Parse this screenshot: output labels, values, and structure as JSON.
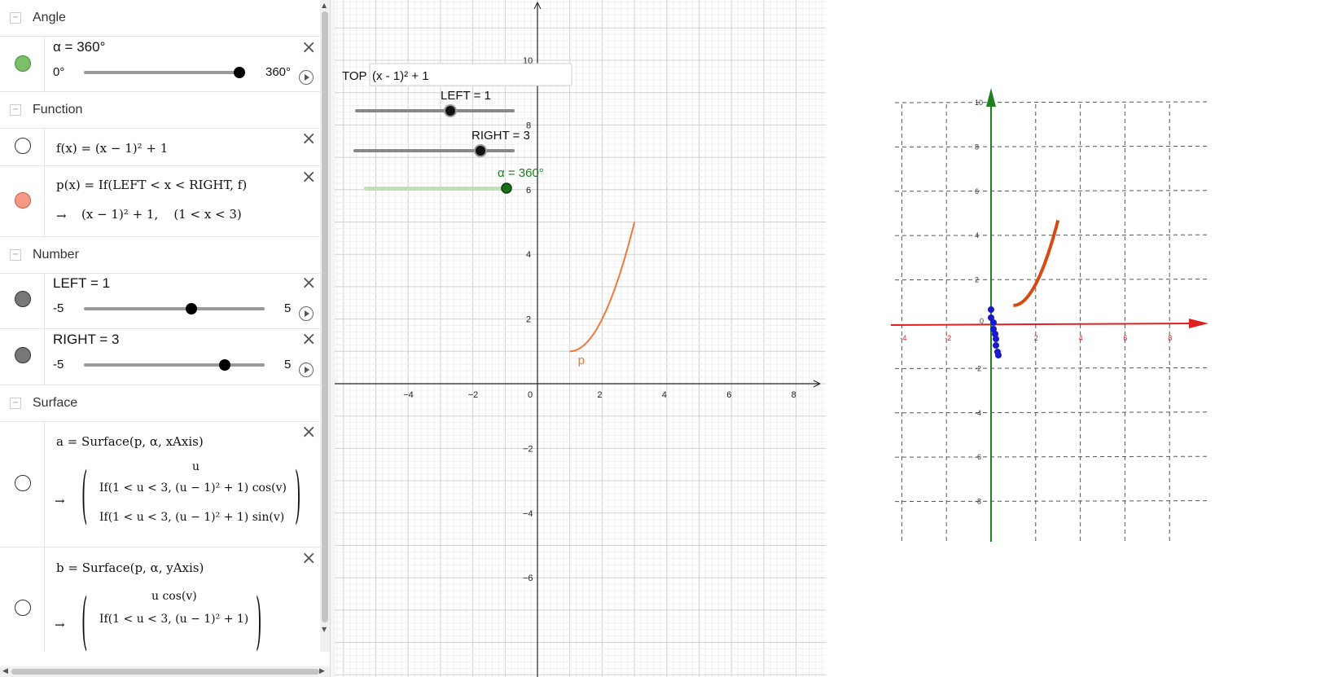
{
  "algebra": {
    "groups": {
      "angle": "Angle",
      "function": "Function",
      "number": "Number",
      "surface": "Surface"
    },
    "alpha": {
      "label": "α = 360°",
      "min": "0°",
      "max": "360°",
      "value": 360,
      "range": [
        0,
        360
      ],
      "marble_color": "#7bbf6a"
    },
    "f": {
      "definition": "f(x) = (x − 1)² + 1",
      "marble_color": "#ffffff"
    },
    "p": {
      "definition": "p(x) = If(LEFT < x < RIGHT, f)",
      "arrow": "→",
      "output": "(x − 1)² + 1,    (1 < x < 3)",
      "marble_color": "#f49a84"
    },
    "left": {
      "label": "LEFT = 1",
      "min": "-5",
      "max": "5",
      "value": 1,
      "range": [
        -5,
        5
      ]
    },
    "right": {
      "label": "RIGHT = 3",
      "min": "-5",
      "max": "5",
      "value": 3,
      "range": [
        -5,
        5
      ]
    },
    "a": {
      "definition": "a = Surface(p, α, xAxis)",
      "arrow": "→",
      "row1": "u",
      "row2": "If(1 < u < 3, (u − 1)² + 1)  cos(v)",
      "row3": "If(1 < u < 3, (u − 1)² + 1)  sin(v)"
    },
    "b": {
      "definition": "b = Surface(p, α, yAxis)",
      "arrow": "→",
      "row1": "u  cos(v)",
      "row2": "If(1 < u < 3, (u − 1)² + 1)"
    }
  },
  "graphics2d": {
    "input_label": "TOP",
    "input_value": "(x - 1)² + 1",
    "slider_left_label": "LEFT = 1",
    "slider_right_label": "RIGHT = 3",
    "slider_alpha_label": "α = 360°",
    "curve_label": "p",
    "curve_color": "#f0783c",
    "x_ticks": [
      "−4",
      "−2",
      "0",
      "2",
      "4",
      "6",
      "8"
    ],
    "y_ticks": [
      "10",
      "8",
      "6",
      "4",
      "2",
      "−2",
      "−4",
      "−6"
    ]
  },
  "graphics3d": {
    "axis_x_color": "#e02020",
    "axis_y_color": "#208020",
    "curve_color": "#d84a14",
    "x_ticks": [
      "-4",
      "-2",
      "0",
      "2",
      "4",
      "6",
      "8"
    ],
    "y_ticks": [
      "10",
      "8",
      "6",
      "4",
      "2",
      "-2",
      "-4",
      "-6",
      "-8"
    ]
  }
}
